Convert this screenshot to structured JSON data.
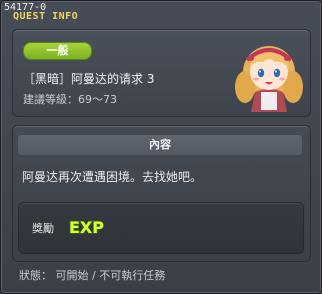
{
  "window": {
    "quest_code": "54177-0",
    "title": "QUEST INFO"
  },
  "quest": {
    "category_badge": "一般",
    "name": "［黑暗］阿曼达的请求 3",
    "recommended_level": "建議等級：69～73",
    "portrait_icon": "amanda-portrait-icon"
  },
  "content": {
    "header": "內容",
    "text": "阿曼达再次遭遇困境。去找她吧。"
  },
  "reward": {
    "label": "獎勵",
    "icon": "exp-icon",
    "icon_text": "EXP"
  },
  "status": {
    "text": "狀態： 可開始 / 不可執行任務"
  },
  "colors": {
    "title": "#f4d35e",
    "badge": "#8fc22d",
    "exp_fill": "#d9ff3b",
    "exp_outline": "#3a6b0a"
  }
}
